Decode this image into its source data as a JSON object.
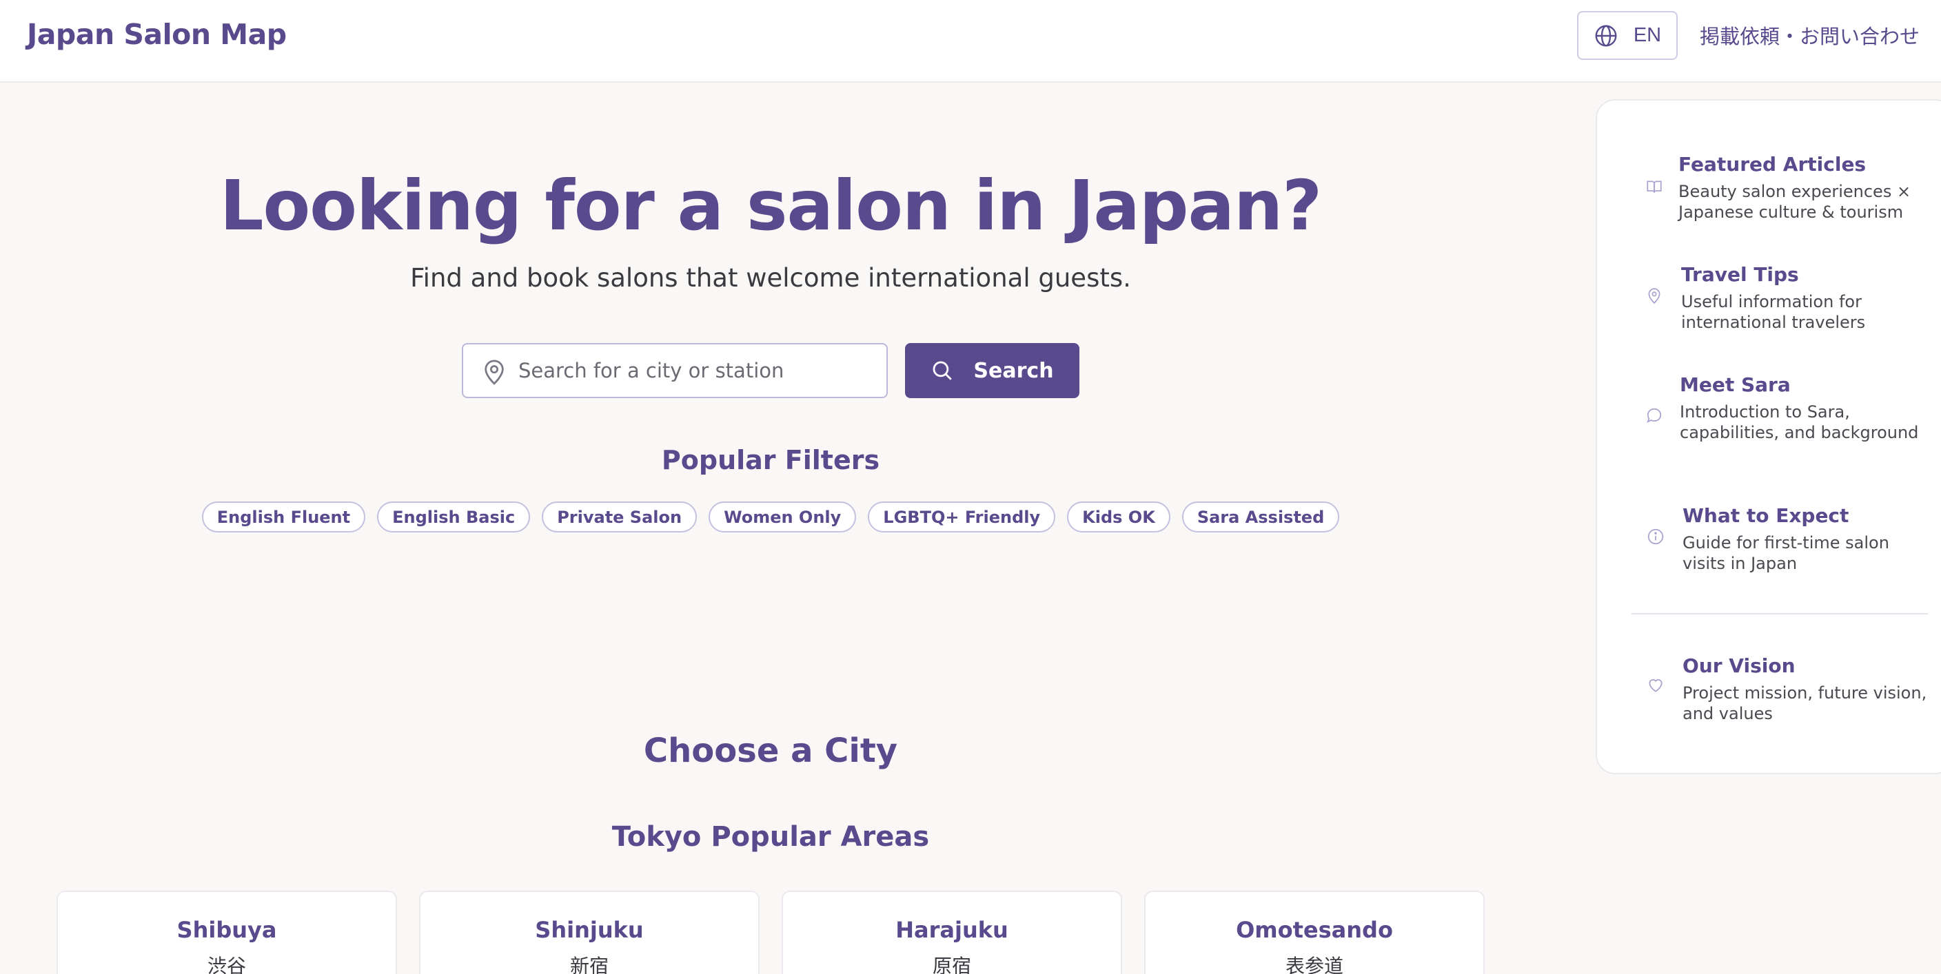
{
  "header": {
    "logo": "Japan Salon Map",
    "lang_label": "EN",
    "contact_label": "掲載依頼・お問い合わせ"
  },
  "hero": {
    "title": "Looking for a salon in Japan?",
    "subtitle": "Find and book salons that welcome international guests."
  },
  "search": {
    "placeholder": "Search for a city or station",
    "value": "",
    "button_label": "Search"
  },
  "filters": {
    "title": "Popular Filters",
    "items": [
      "English Fluent",
      "English Basic",
      "Private Salon",
      "Women Only",
      "LGBTQ+ Friendly",
      "Kids OK",
      "Sara Assisted"
    ]
  },
  "cities": {
    "title": "Choose a City",
    "area_title": "Tokyo Popular Areas",
    "areas": [
      {
        "name": "Shibuya",
        "jp": "渋谷"
      },
      {
        "name": "Shinjuku",
        "jp": "新宿"
      },
      {
        "name": "Harajuku",
        "jp": "原宿"
      },
      {
        "name": "Omotesando",
        "jp": "表参道"
      }
    ]
  },
  "side_panel": {
    "items": [
      {
        "title": "Featured Articles",
        "desc": "Beauty salon experiences × Japanese culture & tourism",
        "icon": "book-icon"
      },
      {
        "title": "Travel Tips",
        "desc": "Useful information for international travelers",
        "icon": "map-pin-icon"
      },
      {
        "title": "Meet Sara",
        "desc": "Introduction to Sara, capabilities, and background",
        "icon": "chat-bubble-icon"
      },
      {
        "title": "What to Expect",
        "desc": "Guide for first-time salon visits in Japan",
        "icon": "info-icon"
      },
      {
        "title": "Our Vision",
        "desc": "Project mission, future vision, and values",
        "icon": "heart-icon"
      }
    ]
  },
  "colors": {
    "brand": "#584a8c",
    "background": "#f9f8f6",
    "surface": "#ffffff"
  }
}
